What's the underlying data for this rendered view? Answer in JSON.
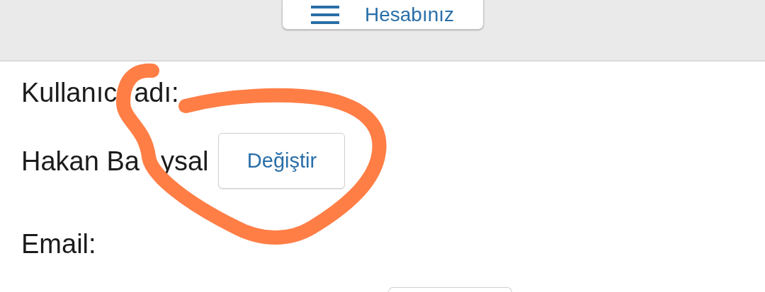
{
  "header": {
    "menu_button": {
      "label": "Hesabınız"
    }
  },
  "fields": [
    {
      "label_parts": [
        "Kullanıc",
        "adı:"
      ],
      "value_parts": [
        "Hakan Ba",
        "ysal"
      ],
      "button": "Değiştir"
    },
    {
      "label_parts": [
        "Email:"
      ]
    }
  ]
}
